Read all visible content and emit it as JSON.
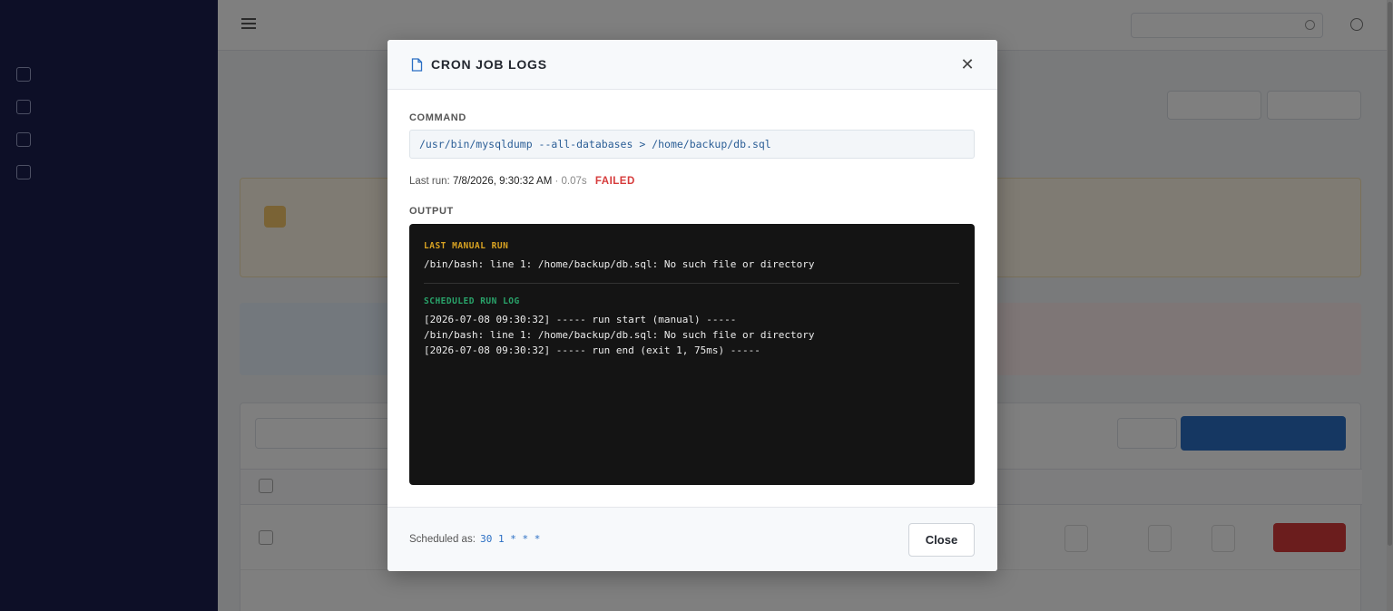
{
  "modal": {
    "title": "CRON JOB LOGS",
    "command_label": "COMMAND",
    "command": "/usr/bin/mysqldump --all-databases > /home/backup/db.sql",
    "last_run_label": "Last run:",
    "last_run_time": "7/8/2026, 9:30:32 AM",
    "duration": "· 0.07s",
    "status": "FAILED",
    "output_label": "OUTPUT",
    "manual_section_title": "LAST MANUAL RUN",
    "manual_lines": [
      "/bin/bash: line 1: /home/backup/db.sql: No such file or directory"
    ],
    "scheduled_section_title": "SCHEDULED RUN LOG",
    "scheduled_lines": [
      "[2026-07-08 09:30:32] ----- run start (manual) -----",
      "/bin/bash: line 1: /home/backup/db.sql: No such file or directory",
      "[2026-07-08 09:30:32] ----- run end (exit 1, 75ms) -----"
    ],
    "scheduled_as_label": "Scheduled as:",
    "scheduled_as_value": "30 1 * * *",
    "close_label": "Close"
  },
  "colors": {
    "status_failed": "#d63b3b",
    "manual_title": "#d9a322",
    "scheduled_title": "#29a36a",
    "terminal_bg": "#141414",
    "sidebar_bg": "#1a1f4e",
    "accent": "#2b6fc4"
  }
}
